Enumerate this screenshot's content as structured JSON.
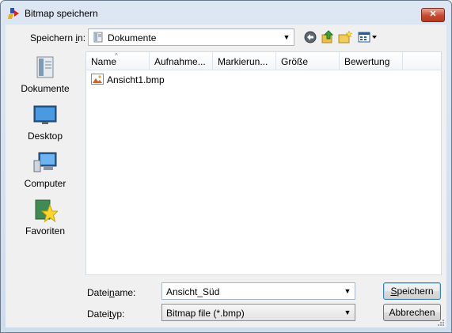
{
  "window": {
    "title": "Bitmap speichern",
    "close_glyph": "✕"
  },
  "savein": {
    "label_pre": "Speichern ",
    "label_ul": "i",
    "label_post": "n:",
    "location": "Dokumente"
  },
  "toolbar": {
    "icons": [
      "back-icon",
      "up-folder-icon",
      "new-folder-icon",
      "views-menu-icon"
    ]
  },
  "places": [
    {
      "label": "Dokumente",
      "icon": "documents-icon"
    },
    {
      "label": "Desktop",
      "icon": "desktop-icon"
    },
    {
      "label": "Computer",
      "icon": "computer-icon"
    },
    {
      "label": "Favoriten",
      "icon": "favorites-icon"
    }
  ],
  "columns": [
    "Name",
    "Aufnahme...",
    "Markierun...",
    "Größe",
    "Bewertung"
  ],
  "files": [
    {
      "name": "Ansicht1.bmp",
      "icon": "bmp-file-icon"
    }
  ],
  "filename": {
    "label_pre": "Datei",
    "label_ul": "n",
    "label_post": "ame:",
    "value": "Ansicht_Süd"
  },
  "filetype": {
    "label_pre": "Datei",
    "label_ul": "t",
    "label_post": "yp:",
    "value": "Bitmap file (*.bmp)"
  },
  "buttons": {
    "save_ul": "S",
    "save_rest": "peichern",
    "cancel": "Abbrechen"
  },
  "colors": {
    "accent": "#3c7fb1",
    "titlebar": "#dce7f3",
    "close": "#c74a30"
  }
}
